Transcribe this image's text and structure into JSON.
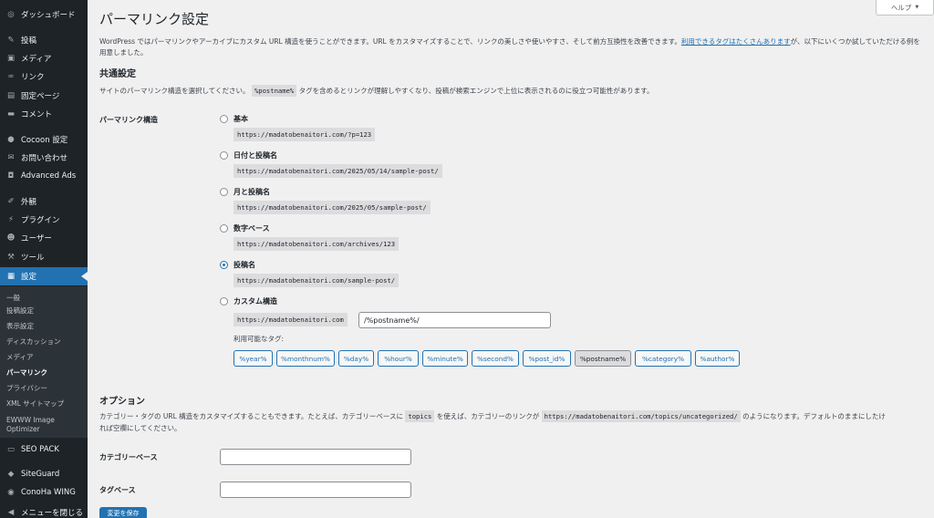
{
  "sidebar": {
    "items": [
      {
        "label": "ダッシュボード",
        "icon": "dashboard-icon",
        "glyph": "◎"
      },
      {
        "label": "投稿",
        "icon": "pin-icon",
        "glyph": "✎"
      },
      {
        "label": "メディア",
        "icon": "media-icon",
        "glyph": "▣"
      },
      {
        "label": "リンク",
        "icon": "link-icon",
        "glyph": "∞"
      },
      {
        "label": "固定ページ",
        "icon": "page-icon",
        "glyph": "▤"
      },
      {
        "label": "コメント",
        "icon": "comment-icon",
        "glyph": "▬"
      },
      {
        "label": "Cocoon 設定",
        "icon": "cocoon-icon",
        "glyph": "●"
      },
      {
        "label": "お問い合わせ",
        "icon": "mail-icon",
        "glyph": "✉"
      },
      {
        "label": "Advanced Ads",
        "icon": "ads-icon",
        "glyph": "◘"
      },
      {
        "label": "外観",
        "icon": "brush-icon",
        "glyph": "✐"
      },
      {
        "label": "プラグイン",
        "icon": "plugin-icon",
        "glyph": "⚡"
      },
      {
        "label": "ユーザー",
        "icon": "user-icon",
        "glyph": "☻"
      },
      {
        "label": "ツール",
        "icon": "wrench-icon",
        "glyph": "⚒"
      },
      {
        "label": "設定",
        "icon": "settings-icon",
        "glyph": "▦"
      }
    ],
    "submenu": [
      "一般",
      "投稿設定",
      "表示設定",
      "ディスカッション",
      "メディア",
      "パーマリンク",
      "プライバシー",
      "XML サイトマップ",
      "EWWW Image Optimizer"
    ],
    "bottom_items": [
      {
        "label": "SEO PACK",
        "icon": "seo-pack-icon",
        "glyph": "▭"
      },
      {
        "label": "SiteGuard",
        "icon": "siteguard-icon",
        "glyph": "◆"
      },
      {
        "label": "ConoHa WING",
        "icon": "conoha-icon",
        "glyph": "◉"
      },
      {
        "label": "メニューを閉じる",
        "icon": "collapse-menu-icon",
        "glyph": "◀"
      }
    ]
  },
  "help_button": {
    "label": "ヘルプ",
    "caret": "▼"
  },
  "page_title": "パーマリンク設定",
  "intro": {
    "text_before": "WordPress ではパーマリンクやアーカイブにカスタム URL 構造を使うことができます。URL をカスタマイズすることで、リンクの美しさや使いやすさ、そして前方互換性を改善できます。",
    "link": "利用できるタグはたくさんあります",
    "text_after": "が、以下にいくつか試していただける例を用意しました。"
  },
  "common": {
    "heading": "共通設定",
    "desc_before": "サイトのパーマリンク構造を選択してください。",
    "desc_code": "%postname%",
    "desc_after": " タグを含めるとリンクが理解しやすくなり、投稿が検索エンジンで上位に表示されるのに役立つ可能性があります。",
    "row_label": "パーマリンク構造",
    "options": [
      {
        "label": "基本",
        "example": "https://madatobenaitori.com/?p=123",
        "checked": false
      },
      {
        "label": "日付と投稿名",
        "example": "https://madatobenaitori.com/2025/05/14/sample-post/",
        "checked": false
      },
      {
        "label": "月と投稿名",
        "example": "https://madatobenaitori.com/2025/05/sample-post/",
        "checked": false
      },
      {
        "label": "数字ベース",
        "example": "https://madatobenaitori.com/archives/123",
        "checked": false
      },
      {
        "label": "投稿名",
        "example": "https://madatobenaitori.com/sample-post/",
        "checked": true
      },
      {
        "label": "カスタム構造",
        "example": "https://madatobenaitori.com",
        "checked": false
      }
    ],
    "custom_value": "/%postname%/",
    "available_tags_label": "利用可能なタグ:",
    "tags": [
      "%year%",
      "%monthnum%",
      "%day%",
      "%hour%",
      "%minute%",
      "%second%",
      "%post_id%",
      "%postname%",
      "%category%",
      "%author%"
    ],
    "pressed_tag": "%postname%"
  },
  "options": {
    "heading": "オプション",
    "desc_1": "カテゴリー・タグの URL 構造をカスタマイズすることもできます。たとえば、カテゴリーベースに",
    "desc_code1": "topics",
    "desc_2": "を使えば、カテゴリーのリンクが",
    "desc_code2": "https://madatobenaitori.com/topics/uncategorized/",
    "desc_3": "のようになります。デフォルトのままにしたけ",
    "desc_4": "れば空欄にしてください。",
    "category_base_label": "カテゴリーベース",
    "category_base_value": "",
    "tag_base_label": "タグベース",
    "tag_base_value": ""
  },
  "save_button": "変更を保存"
}
